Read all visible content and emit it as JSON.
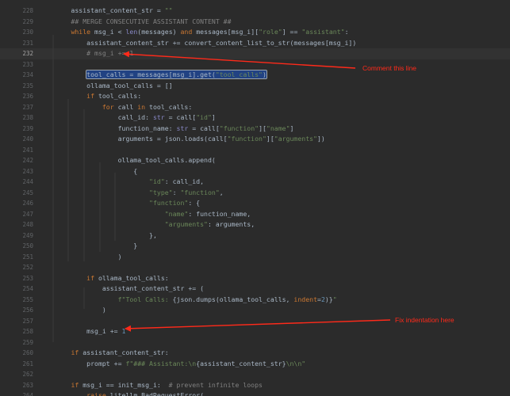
{
  "editor": {
    "lines": [
      {
        "num": "228",
        "tokens": [
          {
            "t": "        assistant_content_str = ",
            "c": "def"
          },
          {
            "t": "\"\"",
            "c": "str"
          }
        ]
      },
      {
        "num": "229",
        "tokens": [
          {
            "t": "        ## MERGE CONSECUTIVE ASSISTANT CONTENT ##",
            "c": "com"
          }
        ]
      },
      {
        "num": "230",
        "tokens": [
          {
            "t": "        ",
            "c": "def"
          },
          {
            "t": "while",
            "c": "kw"
          },
          {
            "t": " msg_i < ",
            "c": "def"
          },
          {
            "t": "len",
            "c": "bi"
          },
          {
            "t": "(messages) ",
            "c": "def"
          },
          {
            "t": "and",
            "c": "kw"
          },
          {
            "t": " messages[msg_i][",
            "c": "def"
          },
          {
            "t": "\"role\"",
            "c": "str"
          },
          {
            "t": "] == ",
            "c": "def"
          },
          {
            "t": "\"assistant\"",
            "c": "str"
          },
          {
            "t": ":",
            "c": "def"
          }
        ]
      },
      {
        "num": "231",
        "tokens": [
          {
            "t": "            assistant_content_str += convert_content_list_to_str(messages[msg_i])",
            "c": "def"
          }
        ]
      },
      {
        "num": "232",
        "current": true,
        "tokens": [
          {
            "t": "            # msg_i += 1",
            "c": "com"
          }
        ]
      },
      {
        "num": "233",
        "tokens": []
      },
      {
        "num": "234",
        "tokens": [
          {
            "t": "            ",
            "c": "def"
          },
          {
            "t": "tool_calls = messages[msg_i].get(",
            "c": "def",
            "sel": true
          },
          {
            "t": "\"tool_calls\"",
            "c": "str",
            "sel": true
          },
          {
            "t": ")",
            "c": "def",
            "sel": true
          }
        ]
      },
      {
        "num": "235",
        "tokens": [
          {
            "t": "            ollama_tool_calls = []",
            "c": "def"
          }
        ]
      },
      {
        "num": "236",
        "tokens": [
          {
            "t": "            ",
            "c": "def"
          },
          {
            "t": "if",
            "c": "kw"
          },
          {
            "t": " tool_calls:",
            "c": "def"
          }
        ]
      },
      {
        "num": "237",
        "tokens": [
          {
            "t": "                ",
            "c": "def"
          },
          {
            "t": "for",
            "c": "kw"
          },
          {
            "t": " call ",
            "c": "def"
          },
          {
            "t": "in",
            "c": "kw"
          },
          {
            "t": " tool_calls:",
            "c": "def"
          }
        ]
      },
      {
        "num": "238",
        "tokens": [
          {
            "t": "                    call_id: ",
            "c": "def"
          },
          {
            "t": "str",
            "c": "bi"
          },
          {
            "t": " = call[",
            "c": "def"
          },
          {
            "t": "\"id\"",
            "c": "str"
          },
          {
            "t": "]",
            "c": "def"
          }
        ]
      },
      {
        "num": "239",
        "tokens": [
          {
            "t": "                    function_name: ",
            "c": "def"
          },
          {
            "t": "str",
            "c": "bi"
          },
          {
            "t": " = call[",
            "c": "def"
          },
          {
            "t": "\"function\"",
            "c": "str"
          },
          {
            "t": "][",
            "c": "def"
          },
          {
            "t": "\"name\"",
            "c": "str"
          },
          {
            "t": "]",
            "c": "def"
          }
        ]
      },
      {
        "num": "240",
        "tokens": [
          {
            "t": "                    arguments = json.loads(call[",
            "c": "def"
          },
          {
            "t": "\"function\"",
            "c": "str"
          },
          {
            "t": "][",
            "c": "def"
          },
          {
            "t": "\"arguments\"",
            "c": "str"
          },
          {
            "t": "])",
            "c": "def"
          }
        ]
      },
      {
        "num": "241",
        "tokens": []
      },
      {
        "num": "242",
        "tokens": [
          {
            "t": "                    ollama_tool_calls.append(",
            "c": "def"
          }
        ]
      },
      {
        "num": "243",
        "tokens": [
          {
            "t": "                        {",
            "c": "def"
          }
        ]
      },
      {
        "num": "244",
        "tokens": [
          {
            "t": "                            ",
            "c": "def"
          },
          {
            "t": "\"id\"",
            "c": "str"
          },
          {
            "t": ": call_id,",
            "c": "def"
          }
        ]
      },
      {
        "num": "245",
        "tokens": [
          {
            "t": "                            ",
            "c": "def"
          },
          {
            "t": "\"type\"",
            "c": "str"
          },
          {
            "t": ": ",
            "c": "def"
          },
          {
            "t": "\"function\"",
            "c": "str"
          },
          {
            "t": ",",
            "c": "def"
          }
        ]
      },
      {
        "num": "246",
        "tokens": [
          {
            "t": "                            ",
            "c": "def"
          },
          {
            "t": "\"function\"",
            "c": "str"
          },
          {
            "t": ": {",
            "c": "def"
          }
        ]
      },
      {
        "num": "247",
        "tokens": [
          {
            "t": "                                ",
            "c": "def"
          },
          {
            "t": "\"name\"",
            "c": "str"
          },
          {
            "t": ": function_name,",
            "c": "def"
          }
        ]
      },
      {
        "num": "248",
        "tokens": [
          {
            "t": "                                ",
            "c": "def"
          },
          {
            "t": "\"arguments\"",
            "c": "str"
          },
          {
            "t": ": arguments,",
            "c": "def"
          }
        ]
      },
      {
        "num": "249",
        "tokens": [
          {
            "t": "                            },",
            "c": "def"
          }
        ]
      },
      {
        "num": "250",
        "tokens": [
          {
            "t": "                        }",
            "c": "def"
          }
        ]
      },
      {
        "num": "251",
        "tokens": [
          {
            "t": "                    )",
            "c": "def"
          }
        ]
      },
      {
        "num": "252",
        "tokens": []
      },
      {
        "num": "253",
        "tokens": [
          {
            "t": "            ",
            "c": "def"
          },
          {
            "t": "if",
            "c": "kw"
          },
          {
            "t": " ollama_tool_calls:",
            "c": "def"
          }
        ]
      },
      {
        "num": "254",
        "tokens": [
          {
            "t": "                assistant_content_str += (",
            "c": "def"
          }
        ]
      },
      {
        "num": "255",
        "tokens": [
          {
            "t": "                    ",
            "c": "def"
          },
          {
            "t": "f\"Tool Calls: ",
            "c": "str"
          },
          {
            "t": "{json.dumps(ollama_tool_calls, ",
            "c": "def"
          },
          {
            "t": "indent",
            "c": "kw"
          },
          {
            "t": "=",
            "c": "def"
          },
          {
            "t": "2",
            "c": "num"
          },
          {
            "t": ")}",
            "c": "def"
          },
          {
            "t": "\"",
            "c": "str"
          }
        ]
      },
      {
        "num": "256",
        "tokens": [
          {
            "t": "                )",
            "c": "def"
          }
        ]
      },
      {
        "num": "257",
        "tokens": []
      },
      {
        "num": "258",
        "tokens": [
          {
            "t": "            msg_i += ",
            "c": "def"
          },
          {
            "t": "1",
            "c": "num"
          }
        ]
      },
      {
        "num": "259",
        "tokens": []
      },
      {
        "num": "260",
        "tokens": [
          {
            "t": "        ",
            "c": "def"
          },
          {
            "t": "if",
            "c": "kw"
          },
          {
            "t": " assistant_content_str:",
            "c": "def"
          }
        ]
      },
      {
        "num": "261",
        "tokens": [
          {
            "t": "            prompt += ",
            "c": "def"
          },
          {
            "t": "f\"### Assistant:\\n",
            "c": "str"
          },
          {
            "t": "{assistant_content_str}",
            "c": "def"
          },
          {
            "t": "\\n\\n\"",
            "c": "str"
          }
        ]
      },
      {
        "num": "262",
        "tokens": []
      },
      {
        "num": "263",
        "tokens": [
          {
            "t": "        ",
            "c": "def"
          },
          {
            "t": "if",
            "c": "kw"
          },
          {
            "t": " msg_i == init_msg_i:  ",
            "c": "def"
          },
          {
            "t": "# prevent infinite loops",
            "c": "com"
          }
        ]
      },
      {
        "num": "264",
        "tokens": [
          {
            "t": "            ",
            "c": "def"
          },
          {
            "t": "raise",
            "c": "kw"
          },
          {
            "t": " litellm.BadRequestError(",
            "c": "def"
          }
        ]
      }
    ]
  },
  "annotations": {
    "note1": "Comment this line",
    "note2": "Fix indentation here",
    "color": "#ff2a1a"
  }
}
